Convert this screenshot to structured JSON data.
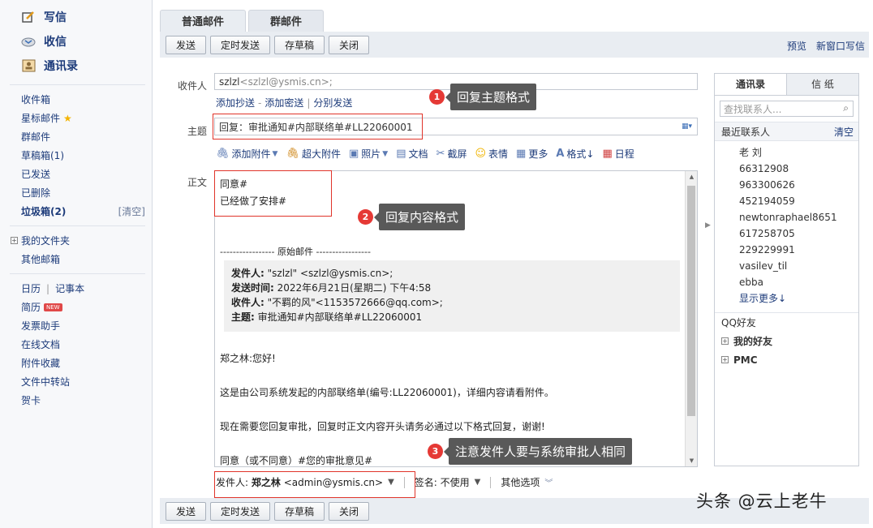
{
  "nav": {
    "write": "写信",
    "inbox": "收信",
    "contacts": "通讯录",
    "folders": [
      {
        "label": "收件箱"
      },
      {
        "label": "星标邮件"
      },
      {
        "label": "群邮件"
      },
      {
        "label": "草稿箱(1)"
      },
      {
        "label": "已发送"
      },
      {
        "label": "已删除"
      }
    ],
    "trash": "垃圾箱(2)",
    "trash_clear": "[清空]",
    "my_folders": "我的文件夹",
    "other_mail": "其他邮箱",
    "calendar": "日历",
    "notes": "记事本",
    "resume": "简历",
    "new_badge": "NEW",
    "tools": [
      {
        "label": "发票助手"
      },
      {
        "label": "在线文档"
      },
      {
        "label": "附件收藏"
      },
      {
        "label": "文件中转站"
      },
      {
        "label": "贺卡"
      }
    ]
  },
  "tabs": {
    "normal": "普通邮件",
    "group": "群邮件"
  },
  "toolbar": {
    "send": "发送",
    "timed_send": "定时发送",
    "save_draft": "存草稿",
    "close": "关闭",
    "preview": "预览",
    "new_window": "新窗口写信"
  },
  "form": {
    "recipient_label": "收件人",
    "recipient_name": "szlzl",
    "recipient_email": "<szlzl@ysmis.cn>;",
    "add_cc": "添加抄送",
    "add_bcc": "添加密送",
    "separate": "分别发送",
    "subject_label": "主题",
    "subject_value": "回复：审批通知#内部联络单#LL22060001",
    "body_label": "正文"
  },
  "editor_toolbar": {
    "attach": "添加附件",
    "big_attach": "超大附件",
    "photo": "照片",
    "doc": "文档",
    "screenshot": "截屏",
    "emoji": "表情",
    "more": "更多",
    "format": "格式↓",
    "schedule": "日程"
  },
  "body": {
    "line1": "同意#",
    "line2": "已经做了安排#",
    "divider": "----------------- 原始邮件 -----------------",
    "orig_from_label": "发件人:",
    "orig_from": " \"szlzl\" <szlzl@ysmis.cn>;",
    "orig_time_label": "发送时间:",
    "orig_time": " 2022年6月21日(星期二) 下午4:58",
    "orig_to_label": "收件人:",
    "orig_to": " \"不羁的风\"<1153572666@qq.com>;",
    "orig_subject_label": "主题:",
    "orig_subject": " 审批通知#内部联络单#LL22060001",
    "greeting": "郑之林:您好!",
    "p1": "这是由公司系统发起的内部联络单(编号:LL22060001)，详细内容请看附件。",
    "p2": "现在需要您回复审批，回复时正文内容开头请务必通过以下格式回复，谢谢!",
    "p3": "同意（或不同意）#您的审批意见#"
  },
  "sender": {
    "label": "发件人:",
    "name": "郑之林",
    "email": "<admin@ysmis.cn>",
    "sign_label": "签名:",
    "sign_value": "不使用",
    "other_options": "其他选项"
  },
  "right_panel": {
    "tab_contacts": "通讯录",
    "tab_stationery": "信 纸",
    "search_placeholder": "查找联系人...",
    "recent_title": "最近联系人",
    "clear": "清空",
    "recent": [
      "老 刘",
      "66312908",
      "963300626",
      "452194059",
      "newtonraphael8651",
      "617258705",
      "229229991",
      "vasilev_til",
      "ebba"
    ],
    "show_more": "显示更多↓",
    "qq_friends": "QQ好友",
    "groups": [
      "我的好友",
      "PMC"
    ]
  },
  "annotations": {
    "n1": "1",
    "a1": "回复主题格式",
    "n2": "2",
    "a2": "回复内容格式",
    "n3": "3",
    "a3": "注意发件人要与系统审批人相同"
  },
  "watermark": "头条 @云上老牛"
}
